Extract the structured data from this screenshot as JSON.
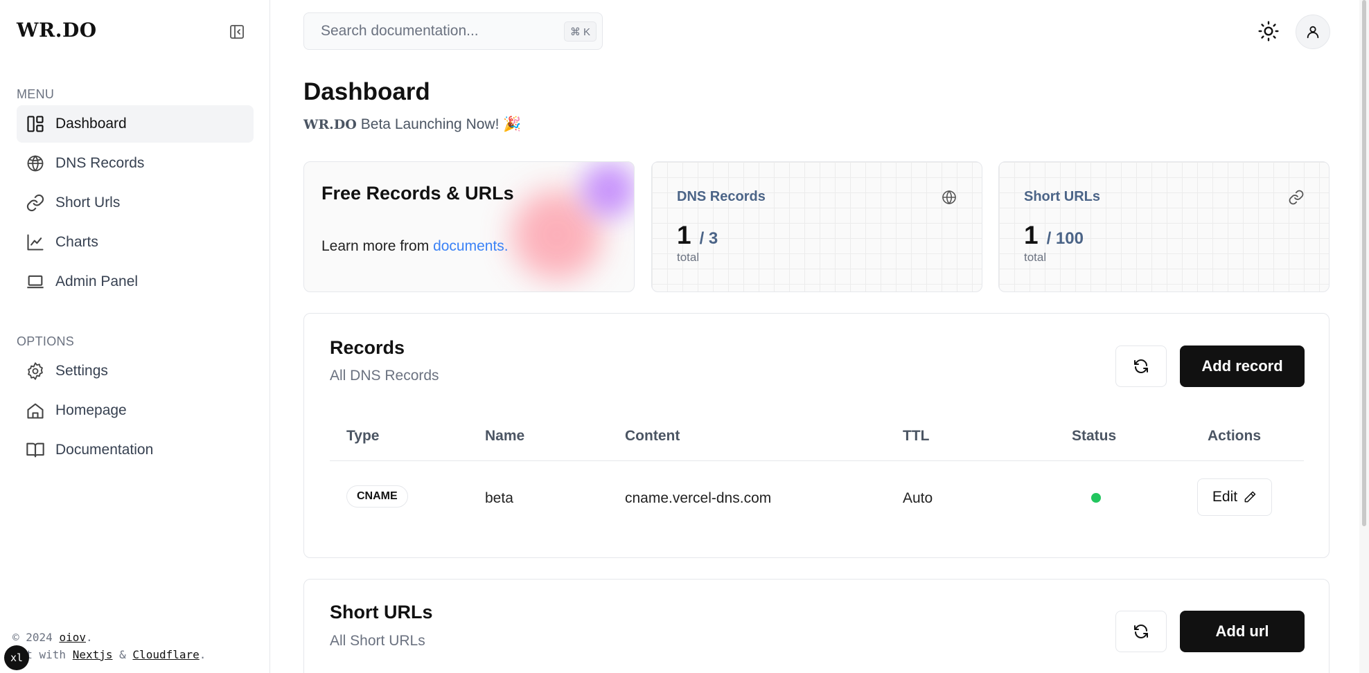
{
  "brand": {
    "logo": "WR.DO"
  },
  "sidebar": {
    "menu_label": "MENU",
    "menu_items": [
      {
        "label": "Dashboard",
        "icon": "dashboard-icon",
        "active": true
      },
      {
        "label": "DNS Records",
        "icon": "globe-icon"
      },
      {
        "label": "Short Urls",
        "icon": "link-icon"
      },
      {
        "label": "Charts",
        "icon": "chart-line-icon"
      },
      {
        "label": "Admin Panel",
        "icon": "laptop-icon"
      }
    ],
    "options_label": "OPTIONS",
    "option_items": [
      {
        "label": "Settings",
        "icon": "gear-icon"
      },
      {
        "label": "Homepage",
        "icon": "home-icon"
      },
      {
        "label": "Documentation",
        "icon": "book-icon"
      }
    ],
    "footer": {
      "copyright": "© 2024",
      "author": "oiov",
      "built_with": "ilt with",
      "nextjs": "Nextjs",
      "amp": "&",
      "cloudflare": "Cloudflare",
      "dot": "."
    },
    "badge": "xl"
  },
  "header": {
    "search_placeholder": "Search documentation...",
    "search_shortcut": "⌘ K"
  },
  "page": {
    "title": "Dashboard",
    "subtitle_brand": "WR.DO",
    "subtitle": "Beta Launching Now! 🎉"
  },
  "cards": {
    "promo": {
      "title": "Free Records & URLs",
      "text": "Learn more from",
      "link": "documents."
    },
    "dns": {
      "title": "DNS Records",
      "value": "1",
      "limit": "/ 3",
      "foot": "total"
    },
    "urls": {
      "title": "Short URLs",
      "value": "1",
      "limit": "/ 100",
      "foot": "total"
    }
  },
  "records": {
    "title": "Records",
    "subtitle": "All DNS Records",
    "add_label": "Add record",
    "columns": [
      "Type",
      "Name",
      "Content",
      "TTL",
      "Status",
      "Actions"
    ],
    "rows": [
      {
        "type": "CNAME",
        "name": "beta",
        "content": "cname.vercel-dns.com",
        "ttl": "Auto",
        "status": "active",
        "action": "Edit"
      }
    ]
  },
  "short_urls": {
    "title": "Short URLs",
    "subtitle": "All Short URLs",
    "add_label": "Add url"
  },
  "colors": {
    "accent": "#111111",
    "link": "#3b82f6",
    "status_active": "#22c55e",
    "stat_title": "#4b6487"
  }
}
